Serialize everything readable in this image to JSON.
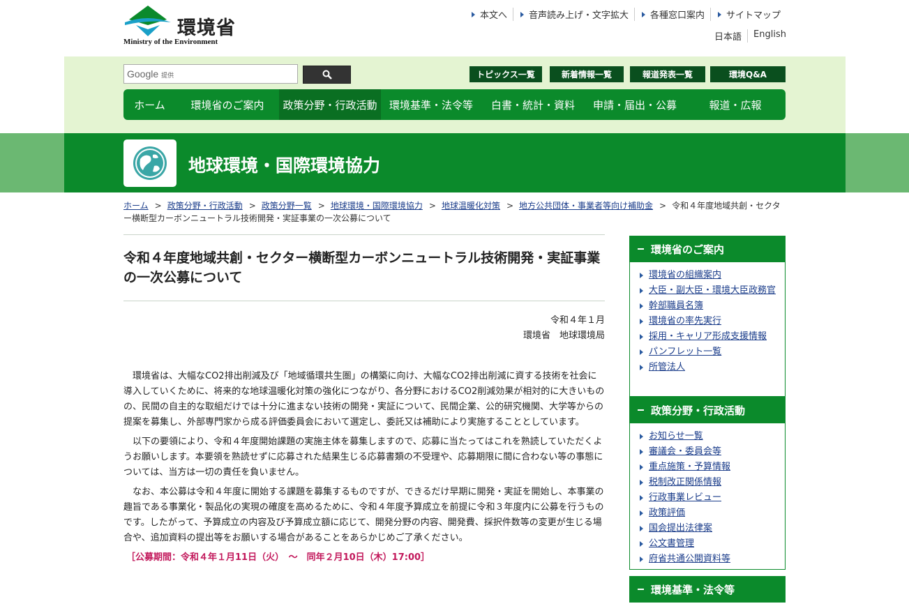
{
  "header": {
    "logo_jp": "環境省",
    "logo_en": "Ministry of the Environment",
    "util_links": [
      "本文へ",
      "音声読み上げ・文字拡大",
      "各種窓口案内",
      "サイトマップ"
    ],
    "lang": [
      "日本語",
      "English"
    ]
  },
  "search": {
    "brand": "Google",
    "brand_sub": "提供"
  },
  "quick_links": [
    "トピックス一覧",
    "新着情報一覧",
    "報道発表一覧",
    "環境Q&A"
  ],
  "nav": [
    "ホーム",
    "環境省のご案内",
    "政策分野・行政活動",
    "環境基準・法令等",
    "白書・統計・資料",
    "申請・届出・公募",
    "報道・広報"
  ],
  "section": {
    "title": "地球環境・国際環境協力"
  },
  "breadcrumb": {
    "links": [
      "ホーム",
      "政策分野・行政活動",
      "政策分野一覧",
      "地球環境・国際環境協力",
      "地球温暖化対策",
      "地方公共団体・事業者等向け補助金"
    ],
    "current": "令和４年度地域共創・セクター横断型カーボンニュートラル技術開発・実証事業の一次公募について"
  },
  "article": {
    "title": "令和４年度地域共創・セクター横断型カーボンニュートラル技術開発・実証事業の一次公募について",
    "date": "令和４年１月",
    "org": "環境省　地球環境局",
    "paragraphs": [
      "環境省は、大幅なCO2排出削減及び「地域循環共生圏」の構築に向け、大幅なCO2排出削減に資する技術を社会に導入していくために、将来的な地球温暖化対策の強化につながり、各分野におけるCO2削減効果が相対的に大きいものの、民間の自主的な取組だけでは十分に進まない技術の開発・実証について、民間企業、公的研究機関、大学等からの提案を募集し、外部専門家から成る評価委員会において選定し、委託又は補助により実施することとしています。",
      "以下の要領により、令和４年度開始課題の実施主体を募集しますので、応募に当たってはこれを熟読していただくようお願いします。本要領を熟読せずに応募された結果生じる応募書類の不受理や、応募期限に間に合わない等の事態については、当方は一切の責任を負いません。",
      "なお、本公募は令和４年度に開始する課題を募集するものですが、できるだけ早期に開発・実証を開始し、本事業の趣旨である事業化・製品化の実現の確度を高めるために、令和４年度予算成立を前提に令和３年度内に公募を行うものです。したがって、予算成立の内容及び予算成立額に応じて、開発分野の内容、開発費、採択件数等の変更が生じる場合や、追加資料の提出等をお願いする場合があることをあらかじめご了承ください。"
    ],
    "period": "［公募期間：令和４年１月11日（火）　～　同年２月10日（木）17:00］"
  },
  "sidebar": [
    {
      "title": "環境省のご案内",
      "items": [
        "環境省の組織案内",
        "大臣・副大臣・環境大臣政務官",
        "幹部職員名簿",
        "環境省の率先実行",
        "採用・キャリア形成支援情報",
        "パンフレット一覧",
        "所管法人"
      ]
    },
    {
      "title": "政策分野・行政活動",
      "items": [
        "お知らせ一覧",
        "審議会・委員会等",
        "重点施策・予算情報",
        "税制改正関係情報",
        "行政事業レビュー",
        "政策評価",
        "国会提出法律案",
        "公文書管理",
        "府省共通公開資料等"
      ]
    },
    {
      "title": "環境基準・法令等",
      "items": []
    }
  ],
  "colors": {
    "brand_green": "#0b8a2b",
    "dark_green": "#0a4f1e",
    "light_band": "#e4f4d2",
    "link": "#1a3c8a",
    "alert": "#c2185b"
  }
}
